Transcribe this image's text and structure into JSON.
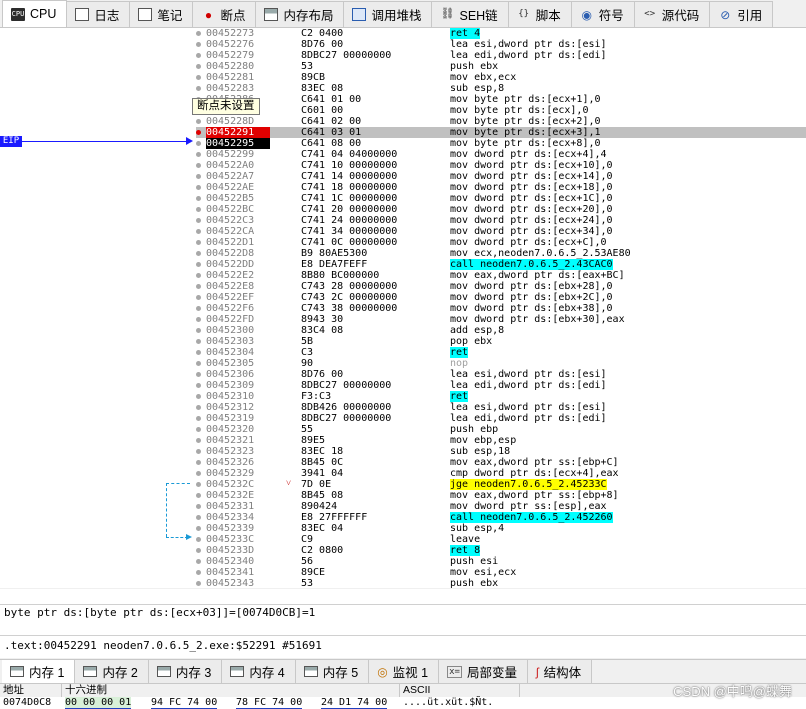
{
  "tabs": [
    {
      "label": "CPU",
      "icon": "cpu-icon"
    },
    {
      "label": "日志",
      "icon": "log-icon"
    },
    {
      "label": "笔记",
      "icon": "notes-icon"
    },
    {
      "label": "断点",
      "icon": "breakpoint-icon"
    },
    {
      "label": "内存布局",
      "icon": "memory-map-icon"
    },
    {
      "label": "调用堆栈",
      "icon": "call-stack-icon"
    },
    {
      "label": "SEH链",
      "icon": "seh-icon"
    },
    {
      "label": "脚本",
      "icon": "script-icon"
    },
    {
      "label": "符号",
      "icon": "symbol-icon"
    },
    {
      "label": "源代码",
      "icon": "source-icon"
    },
    {
      "label": "引用",
      "icon": "reference-icon"
    }
  ],
  "cpu_icon_text": "CPU",
  "eip_label": "EIP",
  "tooltip": "断点未设置",
  "disasm": [
    {
      "addr": "00452273",
      "bytes": "C2 0400",
      "instr": "ret 4"
    },
    {
      "addr": "00452276",
      "bytes": "8D76 00",
      "instr": "lea esi,dword ptr ds:[esi]"
    },
    {
      "addr": "00452279",
      "bytes": "8DBC27 00000000",
      "instr": "lea edi,dword ptr ds:[edi]"
    },
    {
      "addr": "00452280",
      "bytes": "53",
      "instr": "push ebx"
    },
    {
      "addr": "00452281",
      "bytes": "89CB",
      "instr": "mov ebx,ecx"
    },
    {
      "addr": "00452283",
      "bytes": "83EC 08",
      "instr": "sub esp,8"
    },
    {
      "addr": "00452286",
      "bytes": "C641 01 00",
      "instr": "mov byte ptr ds:[ecx+1],0"
    },
    {
      "addr": "0045228A",
      "bytes": "C601 00",
      "instr": "mov byte ptr ds:[ecx],0"
    },
    {
      "addr": "0045228D",
      "bytes": "C641 02 00",
      "instr": "mov byte ptr ds:[ecx+2],0"
    },
    {
      "addr": "00452291",
      "bytes": "C641 03 01",
      "instr": "mov byte ptr ds:[ecx+3],1"
    },
    {
      "addr": "00452295",
      "bytes": "C641 08 00",
      "instr": "mov byte ptr ds:[ecx+8],0"
    },
    {
      "addr": "00452299",
      "bytes": "C741 04 04000000",
      "instr": "mov dword ptr ds:[ecx+4],4"
    },
    {
      "addr": "004522A0",
      "bytes": "C741 10 00000000",
      "instr": "mov dword ptr ds:[ecx+10],0"
    },
    {
      "addr": "004522A7",
      "bytes": "C741 14 00000000",
      "instr": "mov dword ptr ds:[ecx+14],0"
    },
    {
      "addr": "004522AE",
      "bytes": "C741 18 00000000",
      "instr": "mov dword ptr ds:[ecx+18],0"
    },
    {
      "addr": "004522B5",
      "bytes": "C741 1C 00000000",
      "instr": "mov dword ptr ds:[ecx+1C],0"
    },
    {
      "addr": "004522BC",
      "bytes": "C741 20 00000000",
      "instr": "mov dword ptr ds:[ecx+20],0"
    },
    {
      "addr": "004522C3",
      "bytes": "C741 24 00000000",
      "instr": "mov dword ptr ds:[ecx+24],0"
    },
    {
      "addr": "004522CA",
      "bytes": "C741 34 00000000",
      "instr": "mov dword ptr ds:[ecx+34],0"
    },
    {
      "addr": "004522D1",
      "bytes": "C741 0C 00000000",
      "instr": "mov dword ptr ds:[ecx+C],0"
    },
    {
      "addr": "004522D8",
      "bytes": "B9 80AE5300",
      "instr": "mov ecx,neoden7.0.6.5_2.53AE80"
    },
    {
      "addr": "004522DD",
      "bytes": "E8 DEA7FEFF",
      "instr": "call neoden7.0.6.5_2.43CAC0"
    },
    {
      "addr": "004522E2",
      "bytes": "8B80 BC000000",
      "instr": "mov eax,dword ptr ds:[eax+BC]"
    },
    {
      "addr": "004522E8",
      "bytes": "C743 28 00000000",
      "instr": "mov dword ptr ds:[ebx+28],0"
    },
    {
      "addr": "004522EF",
      "bytes": "C743 2C 00000000",
      "instr": "mov dword ptr ds:[ebx+2C],0"
    },
    {
      "addr": "004522F6",
      "bytes": "C743 38 00000000",
      "instr": "mov dword ptr ds:[ebx+38],0"
    },
    {
      "addr": "004522FD",
      "bytes": "8943 30",
      "instr": "mov dword ptr ds:[ebx+30],eax"
    },
    {
      "addr": "00452300",
      "bytes": "83C4 08",
      "instr": "add esp,8"
    },
    {
      "addr": "00452303",
      "bytes": "5B",
      "instr": "pop ebx"
    },
    {
      "addr": "00452304",
      "bytes": "C3",
      "instr": "ret"
    },
    {
      "addr": "00452305",
      "bytes": "90",
      "instr": "nop"
    },
    {
      "addr": "00452306",
      "bytes": "8D76 00",
      "instr": "lea esi,dword ptr ds:[esi]"
    },
    {
      "addr": "00452309",
      "bytes": "8DBC27 00000000",
      "instr": "lea edi,dword ptr ds:[edi]"
    },
    {
      "addr": "00452310",
      "bytes": "F3:C3",
      "instr": "ret"
    },
    {
      "addr": "00452312",
      "bytes": "8DB426 00000000",
      "instr": "lea esi,dword ptr ds:[esi]"
    },
    {
      "addr": "00452319",
      "bytes": "8DBC27 00000000",
      "instr": "lea edi,dword ptr ds:[edi]"
    },
    {
      "addr": "00452320",
      "bytes": "55",
      "instr": "push ebp"
    },
    {
      "addr": "00452321",
      "bytes": "89E5",
      "instr": "mov ebp,esp"
    },
    {
      "addr": "00452323",
      "bytes": "83EC 18",
      "instr": "sub esp,18"
    },
    {
      "addr": "00452326",
      "bytes": "8B45 0C",
      "instr": "mov eax,dword ptr ss:[ebp+C]"
    },
    {
      "addr": "00452329",
      "bytes": "3941 04",
      "instr": "cmp dword ptr ds:[ecx+4],eax"
    },
    {
      "addr": "0045232C",
      "bytes": "7D 0E",
      "instr": "jge neoden7.0.6.5_2.45233C"
    },
    {
      "addr": "0045232E",
      "bytes": "8B45 08",
      "instr": "mov eax,dword ptr ss:[ebp+8]"
    },
    {
      "addr": "00452331",
      "bytes": "890424",
      "instr": "mov dword ptr ss:[esp],eax"
    },
    {
      "addr": "00452334",
      "bytes": "E8 27FFFFFF",
      "instr": "call neoden7.0.6.5_2.452260"
    },
    {
      "addr": "00452339",
      "bytes": "83EC 04",
      "instr": "sub esp,4"
    },
    {
      "addr": "0045233C",
      "bytes": "C9",
      "instr": "leave"
    },
    {
      "addr": "0045233D",
      "bytes": "C2 0800",
      "instr": "ret 8"
    },
    {
      "addr": "00452340",
      "bytes": "56",
      "instr": "push esi"
    },
    {
      "addr": "00452341",
      "bytes": "89CE",
      "instr": "mov esi,ecx"
    },
    {
      "addr": "00452343",
      "bytes": "53",
      "instr": "push ebx"
    }
  ],
  "jump_marker": "˅",
  "scroll_left_arrow": "<",
  "info_line": "byte ptr ds:[byte ptr ds:[ecx+03]]=[0074D0CB]=1",
  "section_line": ".text:00452291 neoden7.0.6.5_2.exe:$52291 #51691",
  "bottom_tabs": [
    {
      "label": "内存 1",
      "icon": "memory-dump-icon"
    },
    {
      "label": "内存 2",
      "icon": "memory-dump-icon"
    },
    {
      "label": "内存 3",
      "icon": "memory-dump-icon"
    },
    {
      "label": "内存 4",
      "icon": "memory-dump-icon"
    },
    {
      "label": "内存 5",
      "icon": "memory-dump-icon"
    },
    {
      "label": "监视 1",
      "icon": "watch-icon"
    },
    {
      "label": "局部变量",
      "icon": "locals-icon"
    },
    {
      "label": "结构体",
      "icon": "struct-icon"
    }
  ],
  "locals_icon_text": "x=",
  "dump_headers": {
    "address": "地址",
    "hex": "十六进制",
    "ascii": "ASCII"
  },
  "dump_row": {
    "address": "0074D0C8",
    "hex_groups": [
      "00 00 00 01",
      "94 FC 74 00",
      "78 FC 74 00",
      "24 D1 74 00"
    ],
    "ascii": "....üt.xüt.$Ñt."
  },
  "watermark": "CSDN @中鸣@蝶舞",
  "colors": {
    "eip_blue": "#1a1aff",
    "breakpoint_red": "#e00000",
    "call_cyan": "#00ffff",
    "jump_yellow": "#ffff00",
    "current_row_gray": "#c0c0c0"
  }
}
